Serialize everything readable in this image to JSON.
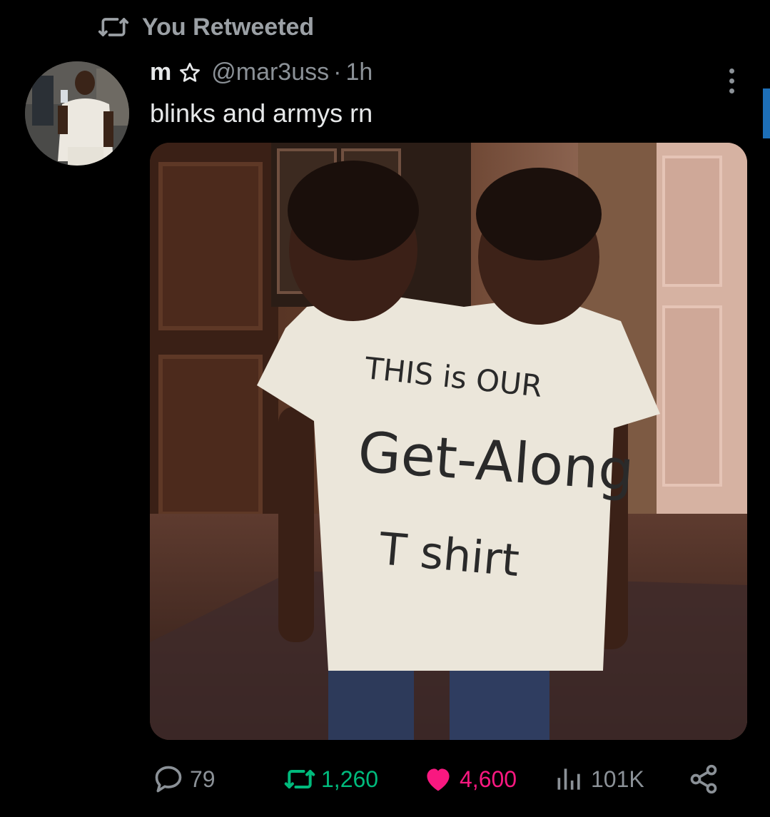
{
  "retweet_context": {
    "label": "You Retweeted"
  },
  "tweet": {
    "display_name": "m",
    "handle": "@mar3uss",
    "separator": "·",
    "time": "1h",
    "text": "blinks and armys rn",
    "media": {
      "shirt_text_line1": "THIS is OUR",
      "shirt_text_line2": "Get-Along",
      "shirt_text_line3": "T shirt"
    }
  },
  "actions": {
    "reply_count": "79",
    "retweet_count": "1,260",
    "like_count": "4,600",
    "view_count": "101K"
  },
  "colors": {
    "background": "#000000",
    "text": "#e7e9ea",
    "muted": "#8b9197",
    "retweet_active": "#00ba7c",
    "like_active": "#f91880"
  },
  "icons": {
    "retweet_context": "retweet-icon",
    "star": "star-outline-icon",
    "more": "more-vertical-icon",
    "reply": "reply-icon",
    "retweet": "retweet-icon",
    "like": "heart-filled-icon",
    "views": "views-bar-chart-icon",
    "share": "share-icon"
  }
}
